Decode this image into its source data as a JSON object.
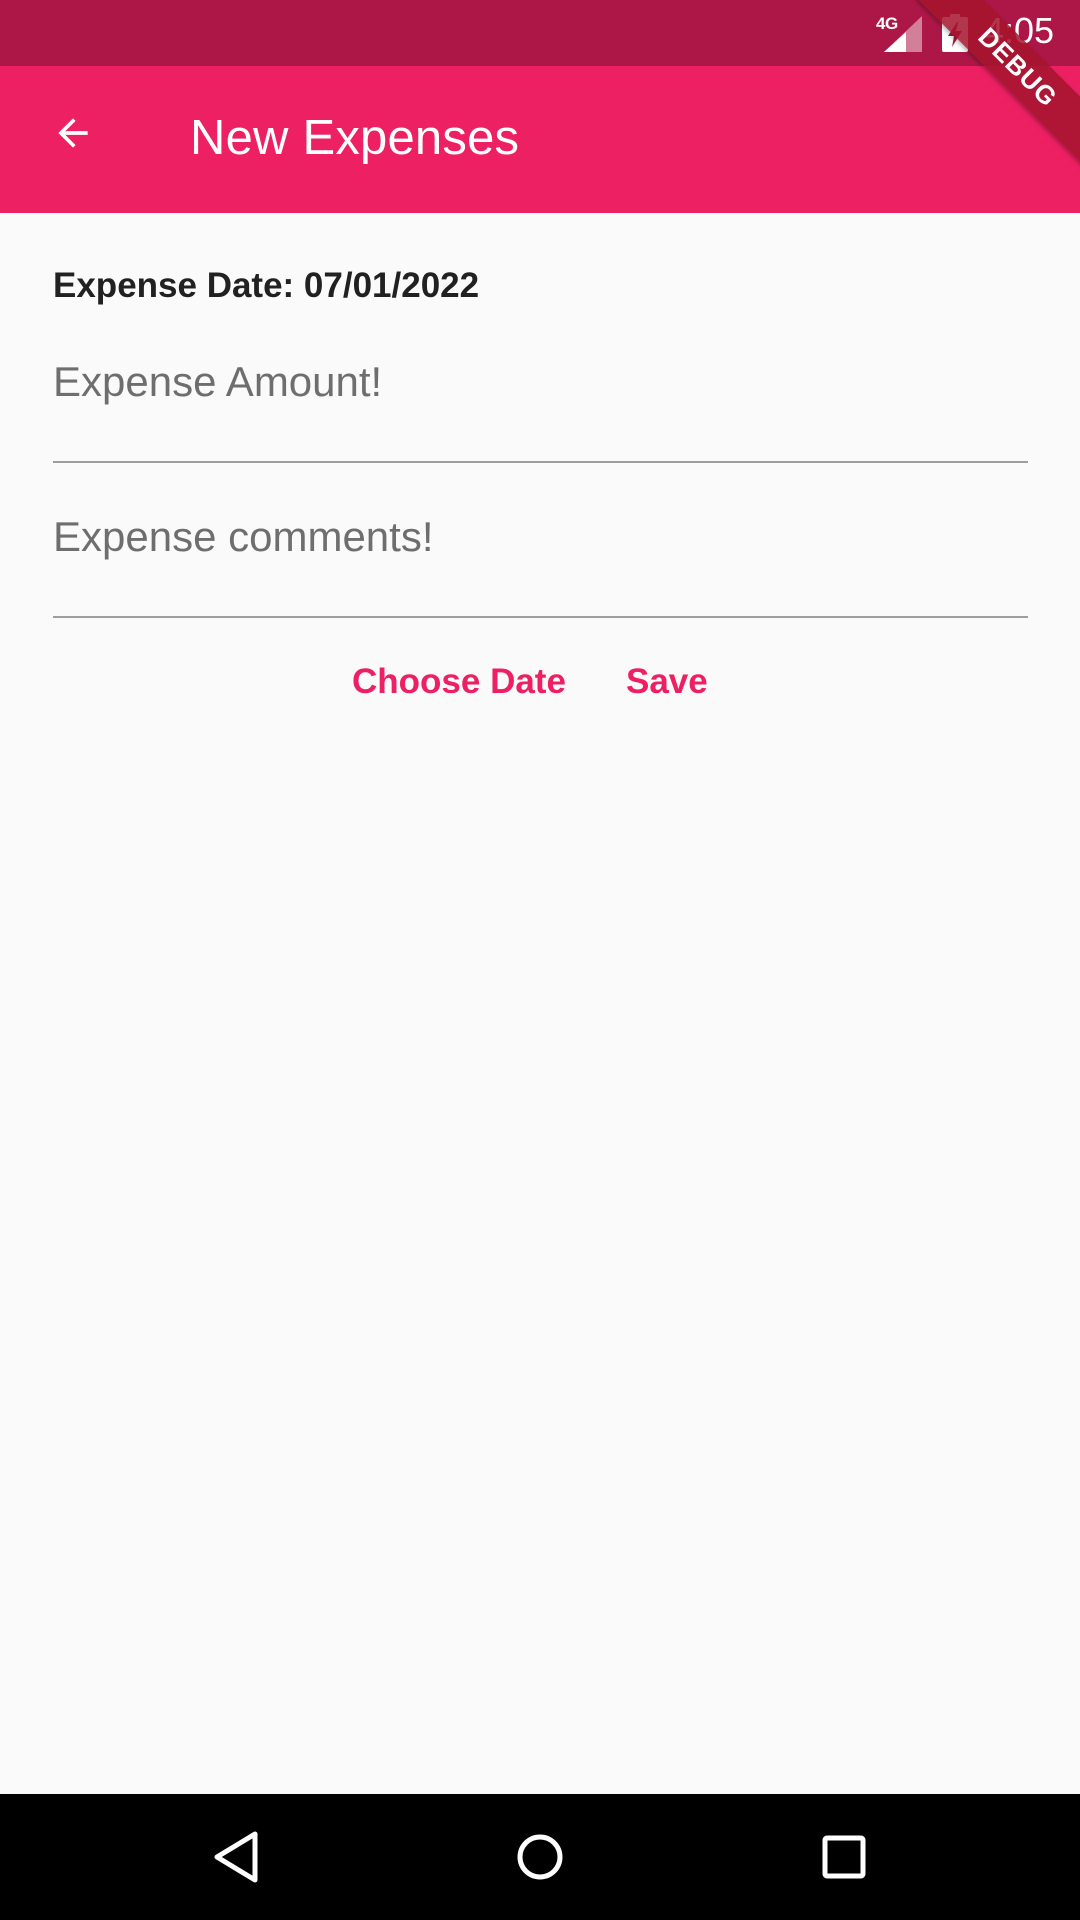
{
  "status_bar": {
    "network": "4G",
    "time": "4:05",
    "icons": [
      "signal-icon",
      "battery-charging-icon"
    ]
  },
  "app_bar": {
    "title": "New Expenses",
    "back_icon": "arrow-back-icon"
  },
  "debug_banner": "DEBUG",
  "form": {
    "date_label": "Expense Date: 07/01/2022",
    "amount_placeholder": "Expense Amount!",
    "amount_value": "",
    "comments_placeholder": "Expense comments!",
    "comments_value": "",
    "choose_date_label": "Choose Date",
    "save_label": "Save"
  },
  "nav_bar": {
    "icons": [
      "nav-back-icon",
      "nav-home-icon",
      "nav-recents-icon"
    ]
  },
  "colors": {
    "status_bar": "#AD1748",
    "app_bar": "#EC2063",
    "accent": "#EC2063",
    "background": "#FAFAFA"
  }
}
